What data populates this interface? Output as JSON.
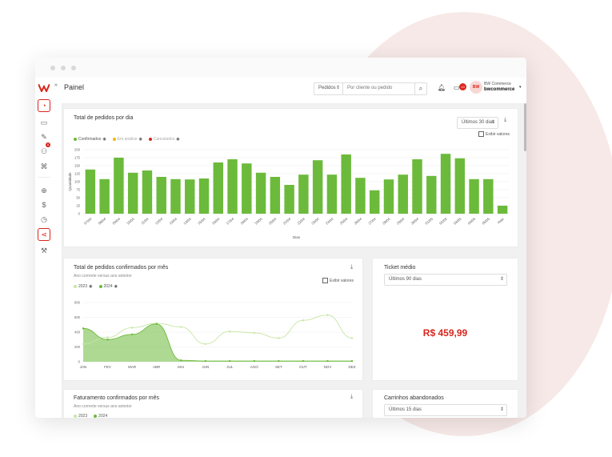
{
  "app": {
    "page_title": "Painel",
    "search_scope": "Pedidos",
    "search_placeholder": "Por cliente ou pedido",
    "notification_count": "13",
    "avatar_initials": "BW",
    "company_top": "BW Commerce",
    "company_bottom": "bwcommerce"
  },
  "colors": {
    "brand": "#d9261c",
    "green": "#6cba3b",
    "light_green": "#c7e6a5",
    "yellow": "#f2b700"
  },
  "sidebar": {
    "icons": [
      "dashboard-icon",
      "monitor-icon",
      "edit-icon",
      "users-icon",
      "command-icon",
      "plus-circle-icon",
      "dollar-icon",
      "clock-icon",
      "share-icon",
      "wrench-icon"
    ],
    "users_badge": "6",
    "collapse_glyph": "»"
  },
  "daily": {
    "title": "Total de pedidos por dia",
    "period": "Últimos 30 dias",
    "show_values": "Exibir valores",
    "legend": [
      "Confirmados",
      "Em análise",
      "Cancelados"
    ]
  },
  "monthly": {
    "title": "Total de pedidos confirmados por mês",
    "subtitle": "Ano corrente versus ano anterior",
    "show_values": "Exibir valores"
  },
  "ticket": {
    "title": "Ticket médio",
    "period": "Últimos 90 dias",
    "value": "R$ 459,99"
  },
  "billing": {
    "title": "Faturamento confirmados por mês",
    "subtitle": "Ano corrente versus ano anterior",
    "legend": [
      "2023",
      "2024"
    ]
  },
  "carts": {
    "title": "Carrinhos abandonados",
    "period": "Últimos 15 dias"
  },
  "chart_data": [
    {
      "type": "bar",
      "title": "Total de pedidos por dia",
      "xlabel": "Dias",
      "ylabel": "Quantidade",
      "ylim": [
        0,
        200
      ],
      "yticks": [
        0,
        25,
        50,
        75,
        100,
        125,
        150,
        175,
        200
      ],
      "categories": [
        "07/04",
        "08/04",
        "09/04",
        "10/04",
        "11/04",
        "12/04",
        "13/04",
        "14/04",
        "15/04",
        "16/04",
        "17/04",
        "18/04",
        "19/04",
        "20/04",
        "21/04",
        "22/04",
        "23/04",
        "24/04",
        "25/04",
        "26/04",
        "27/04",
        "28/04",
        "29/04",
        "30/04",
        "01/05",
        "02/05",
        "03/05",
        "04/05",
        "05/05",
        "Hoje"
      ],
      "series": [
        {
          "name": "Confirmados",
          "values": [
            138,
            108,
            175,
            128,
            135,
            115,
            108,
            107,
            110,
            160,
            170,
            157,
            128,
            115,
            90,
            122,
            167,
            122,
            185,
            112,
            73,
            107,
            122,
            170,
            118,
            187,
            173,
            108,
            108,
            25
          ]
        }
      ]
    },
    {
      "type": "line",
      "title": "Total de pedidos confirmados por mês",
      "ylim": [
        0,
        800
      ],
      "yticks": [
        0,
        200,
        400,
        600,
        800
      ],
      "categories": [
        "JAN",
        "FEV",
        "MAR",
        "ABR",
        "MAI",
        "JUN",
        "JUL",
        "AGO",
        "SET",
        "OUT",
        "NOV",
        "DEZ"
      ],
      "series": [
        {
          "name": "2023",
          "values": [
            240,
            330,
            460,
            520,
            470,
            240,
            410,
            390,
            320,
            560,
            630,
            320
          ]
        },
        {
          "name": "2024",
          "values": [
            450,
            300,
            370,
            510,
            20,
            10,
            10,
            10,
            10,
            10,
            10,
            10
          ]
        }
      ]
    }
  ]
}
